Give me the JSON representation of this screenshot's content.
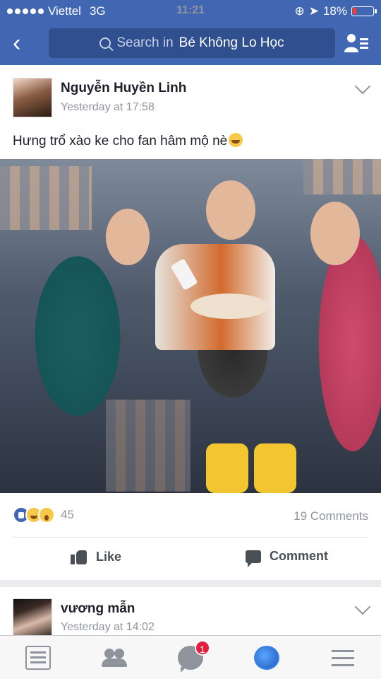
{
  "status_bar": {
    "carrier": "Viettel",
    "network": "3G",
    "time": "11:21",
    "battery": "18%",
    "battery_level": 0.18
  },
  "header": {
    "search_prefix": "Search in",
    "group_name": "Bé Không Lo Học"
  },
  "post": {
    "author": "Nguyễn Huyền Linh",
    "timestamp": "Yesterday at 17:58",
    "caption": "Hưng trổ xào ke cho fan hâm mộ nè",
    "reaction_count": "45",
    "comments_count": "19 Comments",
    "like_label": "Like",
    "comment_label": "Comment"
  },
  "post2": {
    "author": "vương mẫn",
    "timestamp": "Yesterday at 14:02"
  },
  "nav": {
    "message_badge": "1",
    "accent": "#4267b2"
  }
}
